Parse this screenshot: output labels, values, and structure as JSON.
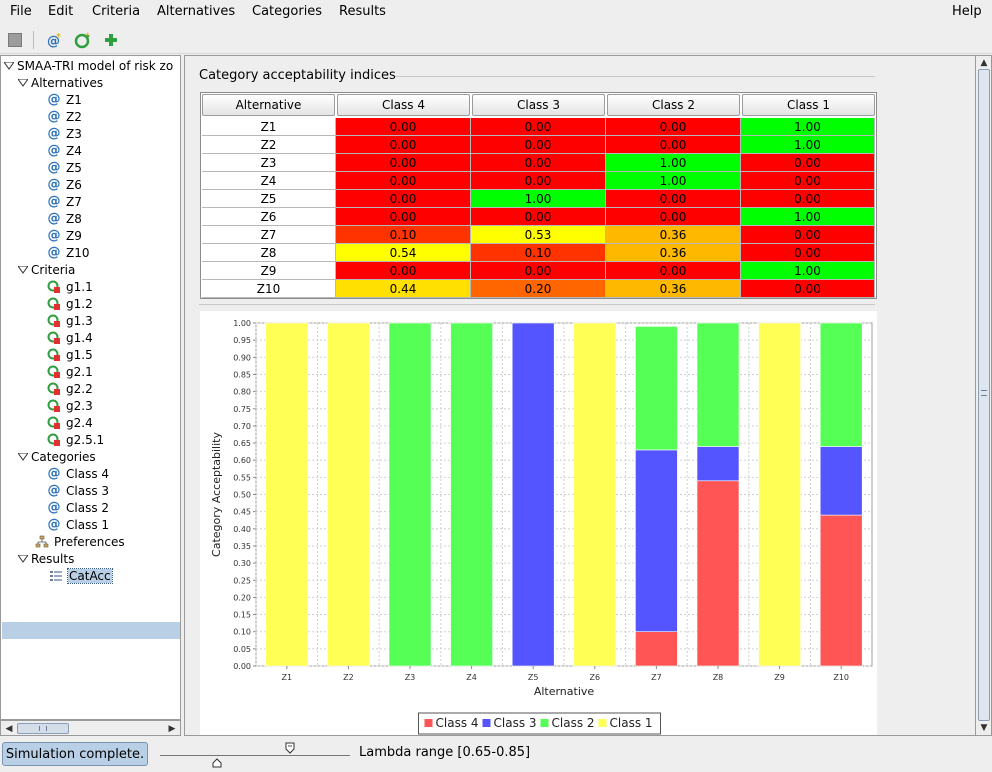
{
  "menu": [
    "File",
    "Edit",
    "Criteria",
    "Alternatives",
    "Categories",
    "Results"
  ],
  "help": "Help",
  "toolbar": {
    "items": [
      {
        "icon": "save-icon"
      },
      {
        "icon": "add-alternative-icon"
      },
      {
        "icon": "add-criterion-icon"
      },
      {
        "icon": "add-category-icon"
      }
    ]
  },
  "tree": {
    "root": "SMAA-TRI model of risk zo",
    "alternatives_label": "Alternatives",
    "alternatives": [
      "Z1",
      "Z2",
      "Z3",
      "Z4",
      "Z5",
      "Z6",
      "Z7",
      "Z8",
      "Z9",
      "Z10"
    ],
    "criteria_label": "Criteria",
    "criteria": [
      "g1.1",
      "g1.2",
      "g1.3",
      "g1.4",
      "g1.5",
      "g2.1",
      "g2.2",
      "g2.3",
      "g2.4",
      "g2.5.1"
    ],
    "categories_label": "Categories",
    "categories": [
      "Class 4",
      "Class 3",
      "Class 2",
      "Class 1"
    ],
    "preferences": "Preferences",
    "results_label": "Results",
    "results": [
      "CatAcc"
    ]
  },
  "main": {
    "title": "Category acceptability indices",
    "table": {
      "headers": [
        "Alternative",
        "Class 4",
        "Class 3",
        "Class 2",
        "Class 1"
      ],
      "rows": [
        {
          "name": "Z1",
          "values": [
            "0.00",
            "0.00",
            "0.00",
            "1.00"
          ]
        },
        {
          "name": "Z2",
          "values": [
            "0.00",
            "0.00",
            "0.00",
            "1.00"
          ]
        },
        {
          "name": "Z3",
          "values": [
            "0.00",
            "0.00",
            "1.00",
            "0.00"
          ]
        },
        {
          "name": "Z4",
          "values": [
            "0.00",
            "0.00",
            "1.00",
            "0.00"
          ]
        },
        {
          "name": "Z5",
          "values": [
            "0.00",
            "1.00",
            "0.00",
            "0.00"
          ]
        },
        {
          "name": "Z6",
          "values": [
            "0.00",
            "0.00",
            "0.00",
            "1.00"
          ]
        },
        {
          "name": "Z7",
          "values": [
            "0.10",
            "0.53",
            "0.36",
            "0.00"
          ]
        },
        {
          "name": "Z8",
          "values": [
            "0.54",
            "0.10",
            "0.36",
            "0.00"
          ]
        },
        {
          "name": "Z9",
          "values": [
            "0.00",
            "0.00",
            "0.00",
            "1.00"
          ]
        },
        {
          "name": "Z10",
          "values": [
            "0.44",
            "0.20",
            "0.36",
            "0.00"
          ]
        }
      ]
    }
  },
  "chart_data": {
    "type": "bar",
    "stacked": true,
    "title": "",
    "xlabel": "Alternative",
    "ylabel": "Category Acceptability",
    "ylim": [
      0,
      1
    ],
    "yticks": [
      "0.00",
      "0.05",
      "0.10",
      "0.15",
      "0.20",
      "0.25",
      "0.30",
      "0.35",
      "0.40",
      "0.45",
      "0.50",
      "0.55",
      "0.60",
      "0.65",
      "0.70",
      "0.75",
      "0.80",
      "0.85",
      "0.90",
      "0.95",
      "1.00"
    ],
    "categories": [
      "Z1",
      "Z2",
      "Z3",
      "Z4",
      "Z5",
      "Z6",
      "Z7",
      "Z8",
      "Z9",
      "Z10"
    ],
    "series": [
      {
        "name": "Class 4",
        "color": "#ff5555",
        "values": [
          0,
          0,
          0,
          0,
          0,
          0,
          0.1,
          0.54,
          0,
          0.44
        ]
      },
      {
        "name": "Class 3",
        "color": "#5555ff",
        "values": [
          0,
          0,
          0,
          0,
          1.0,
          0,
          0.53,
          0.1,
          0,
          0.2
        ]
      },
      {
        "name": "Class 2",
        "color": "#55ff55",
        "values": [
          0,
          0,
          1.0,
          1.0,
          0,
          0,
          0.36,
          0.36,
          0,
          0.36
        ]
      },
      {
        "name": "Class 1",
        "color": "#ffff55",
        "values": [
          1.0,
          1.0,
          0,
          0,
          0,
          1.0,
          0,
          0,
          1.0,
          0
        ]
      }
    ],
    "grid": true,
    "legend": "bottom-center"
  },
  "status": {
    "message": "Simulation complete.",
    "lambda": "Lambda range [0.65-0.85]"
  }
}
